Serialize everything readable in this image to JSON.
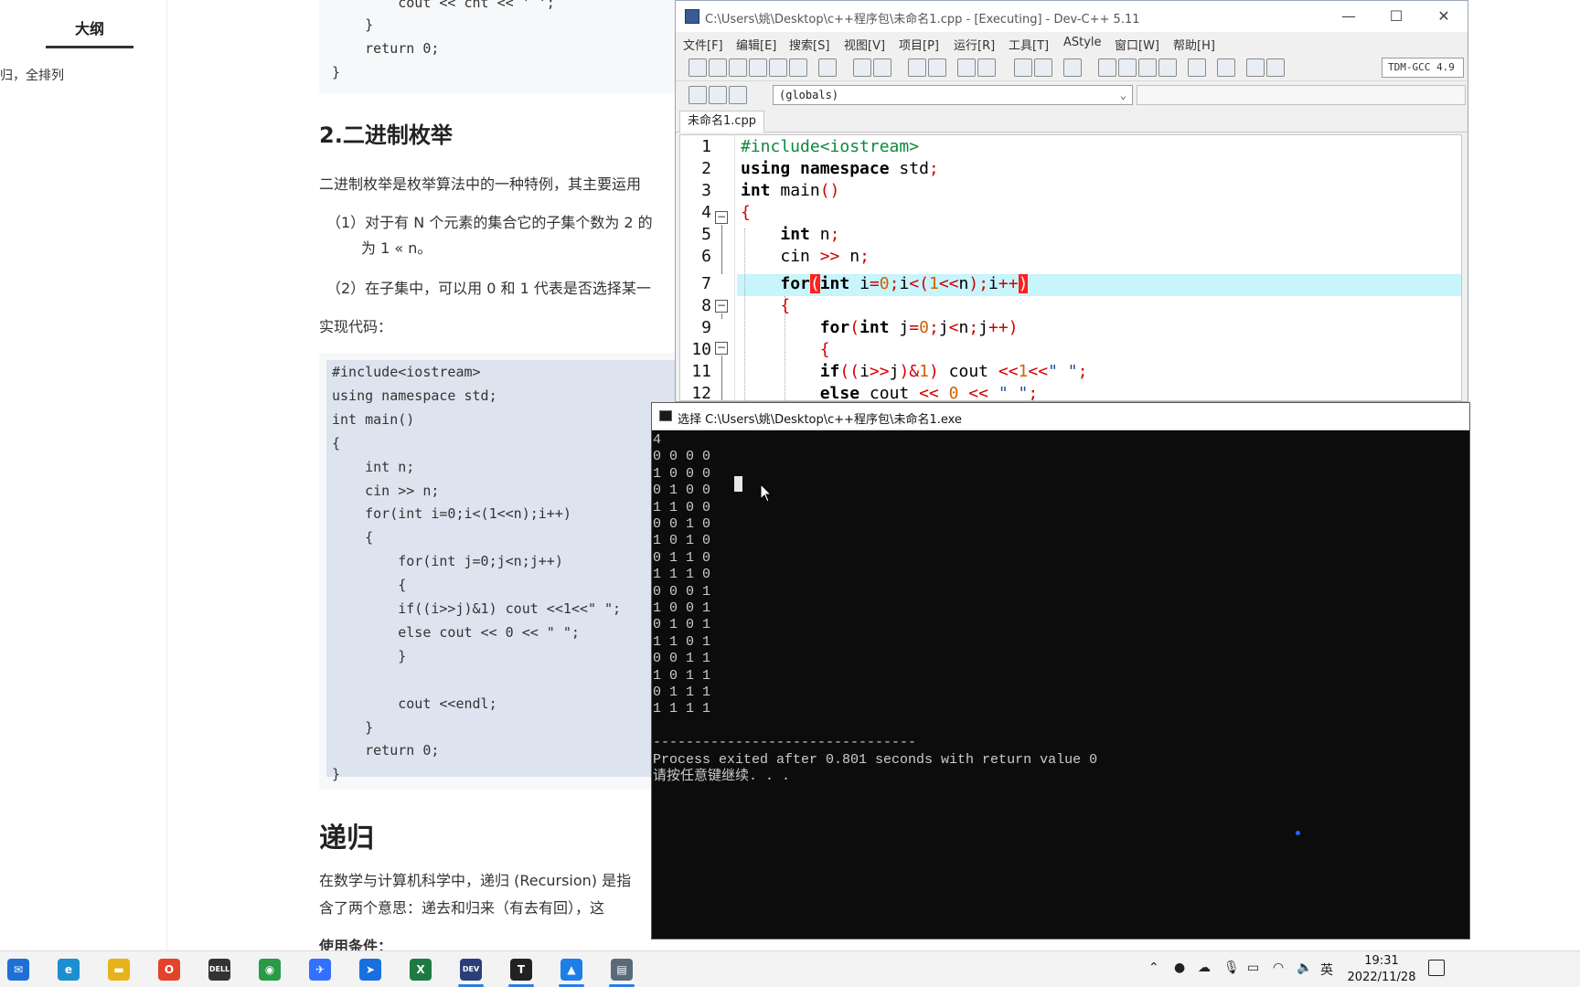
{
  "article": {
    "outline_title": "大纲",
    "outline_item": "归，全排列",
    "top_code": [
      "        cout << cnt << ' ';",
      "    }",
      "    return 0;",
      "}"
    ],
    "section2_title": "2.二进制枚举",
    "section2_para1": "二进制枚举是枚举算法中的一种特例，其主要运用",
    "section2_item1_a": "（1）对于有 N 个元素的集合它的子集个数为 2 的",
    "section2_item1_b": "为 1 « n。",
    "section2_item2": "（2）在子集中，可以用 0 和 1 代表是否选择某一",
    "impl_label": "实现代码：",
    "code_lines": [
      "#include<iostream>",
      "using namespace std;",
      "int main()",
      "{",
      "    int n;",
      "    cin >> n;",
      "    for(int i=0;i<(1<<n);i++)",
      "    {",
      "        for(int j=0;j<n;j++)",
      "        {",
      "        if((i>>j)&1) cout <<1<<\" \";",
      "        else cout << 0 << \" \";",
      "        }",
      "",
      "        cout <<endl;",
      "    }",
      "    return 0;",
      "}"
    ],
    "recursion_title": "递归",
    "recursion_para1": "在数学与计算机科学中，递归 (Recursion) 是指",
    "recursion_para2": "含了两个意思：递去和归来（有去有回），这",
    "usage_label": "使用条件："
  },
  "devcpp": {
    "title": "C:\\Users\\姚\\Desktop\\c++程序包\\未命名1.cpp - [Executing] - Dev-C++ 5.11",
    "menu": [
      "文件[F]",
      "编辑[E]",
      "搜索[S]",
      "视图[V]",
      "项目[P]",
      "运行[R]",
      "工具[T]",
      "AStyle",
      "窗口[W]",
      "帮助[H]"
    ],
    "compiler": "TDM-GCC 4.9",
    "scope": "(globals)",
    "tab": "未命名1.cpp",
    "line_numbers": [
      "1",
      "2",
      "3",
      "4",
      "5",
      "6",
      "7",
      "8",
      "9",
      "10",
      "11",
      "12"
    ],
    "code": {
      "l1": "#include<iostream>",
      "l2_kw": "using namespace",
      "l2_rest": " std",
      "l3_kw": "int",
      "l3_rest": " main",
      "l5_kw": "int",
      "l5_rest": " n",
      "l6_a": "cin ",
      "l6_op": ">>",
      "l6_b": " n",
      "l7_kw": "for",
      "l7_int": "int",
      "l7_a": " i",
      "l7_b": "0",
      "l7_c": "i",
      "l7_d": "1",
      "l7_e": "n",
      "l7_f": "i",
      "l9_kw": "for",
      "l9_int": "int",
      "l9_a": " j",
      "l9_b": "0",
      "l9_c": "j",
      "l9_d": "n",
      "l9_e": "j",
      "l11_kw": "if",
      "l11_a": "i",
      "l11_b": "j",
      "l11_c": "1",
      "l11_d": " cout ",
      "l11_e": "1",
      "l11_str": "\" \"",
      "l12_kw": "else",
      "l12_a": " cout ",
      "l12_b": "0",
      "l12_str": "\" \""
    }
  },
  "console": {
    "title": "选择 C:\\Users\\姚\\Desktop\\c++程序包\\未命名1.exe",
    "lines": [
      "4",
      "0 0 0 0",
      "1 0 0 0",
      "0 1 0 0",
      "1 1 0 0",
      "0 0 1 0",
      "1 0 1 0",
      "0 1 1 0",
      "1 1 1 0",
      "0 0 0 1",
      "1 0 0 1",
      "0 1 0 1",
      "1 1 0 1",
      "0 0 1 1",
      "1 0 1 1",
      "0 1 1 1",
      "1 1 1 1",
      "",
      "--------------------------------",
      "Process exited after 0.801 seconds with return value 0",
      "请按任意键继续. . ."
    ]
  },
  "taskbar": {
    "apps": [
      {
        "icon": "mail-icon",
        "glyph": "✉",
        "color": "#1e6fd6"
      },
      {
        "icon": "edge-icon",
        "glyph": "e",
        "color": "#1b8fd0"
      },
      {
        "icon": "file-explorer-icon",
        "glyph": "▬",
        "color": "#e7b31b"
      },
      {
        "icon": "office-icon",
        "glyph": "O",
        "color": "#e2432a"
      },
      {
        "icon": "dell-icon",
        "glyph": "DELL",
        "color": "#333333"
      },
      {
        "icon": "chrome-icon",
        "glyph": "◉",
        "color": "#2b9a47"
      },
      {
        "icon": "feishu-icon",
        "glyph": "✈",
        "color": "#3370ff"
      },
      {
        "icon": "pin-icon",
        "glyph": "➤",
        "color": "#1a6fe0"
      },
      {
        "icon": "excel-icon",
        "glyph": "X",
        "color": "#1d7a43"
      },
      {
        "icon": "devcpp-icon",
        "glyph": "DEV",
        "color": "#2a3f7a"
      },
      {
        "icon": "typora-icon",
        "glyph": "T",
        "color": "#222222"
      },
      {
        "icon": "photos-icon",
        "glyph": "▲",
        "color": "#1d7ee8"
      },
      {
        "icon": "console-icon",
        "glyph": "▤",
        "color": "#5a6a7a"
      }
    ],
    "ime": "英",
    "time": "19:31",
    "date": "2022/11/28"
  },
  "colors": {
    "keyword": "#000000",
    "preprocessor": "#0a8a3a",
    "symbol": "#d00000",
    "number": "#d06000",
    "current_line": "#c8f4fb",
    "console_bg": "#0c0c0c"
  }
}
